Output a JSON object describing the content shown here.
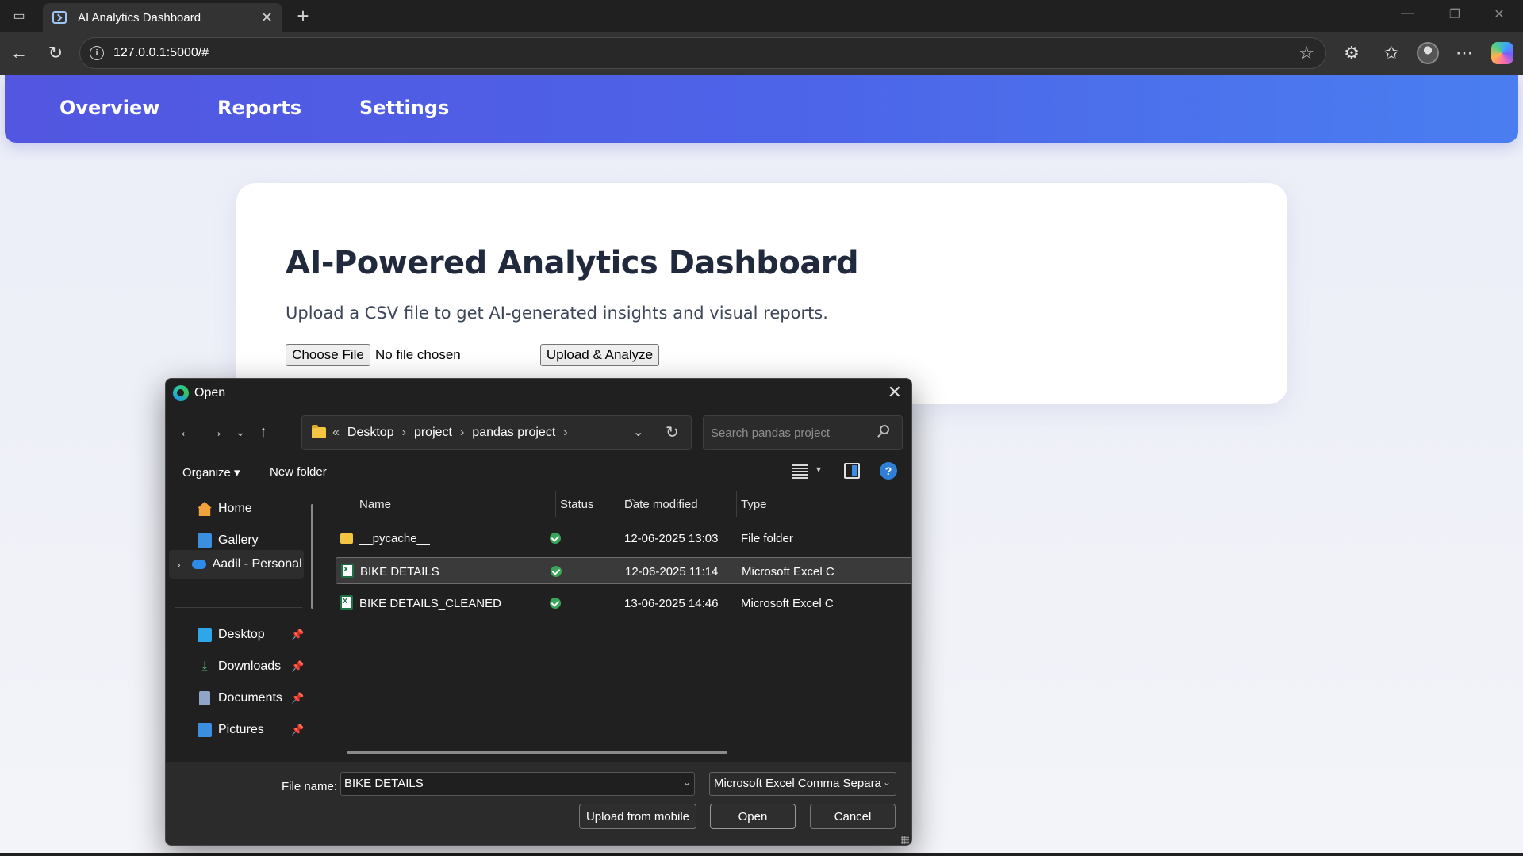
{
  "browser": {
    "tab_title": "AI Analytics Dashboard",
    "tab_close": "✕",
    "new_tab": "+",
    "url": "127.0.0.1:5000/#",
    "info_glyph": "i"
  },
  "nav": {
    "links": [
      "Overview",
      "Reports",
      "Settings"
    ]
  },
  "card": {
    "title": "AI-Powered Analytics Dashboard",
    "subtitle": "Upload a CSV file to get AI-generated insights and visual reports.",
    "choose_file_label": "Choose File",
    "no_file_text": "No file chosen",
    "upload_label": "Upload & Analyze"
  },
  "dialog": {
    "title": "Open",
    "close_glyph": "✕",
    "breadcrumb": [
      "Desktop",
      "project",
      "pandas project"
    ],
    "breadcrumb_prefix": "«",
    "search_placeholder": "Search pandas project",
    "organize_label": "Organize ▾",
    "new_folder_label": "New folder",
    "help_glyph": "?",
    "sidebar": {
      "home": "Home",
      "gallery": "Gallery",
      "onedrive": "Aadil - Personal",
      "desktop": "Desktop",
      "downloads": "Downloads",
      "documents": "Documents",
      "pictures": "Pictures"
    },
    "columns": {
      "name": "Name",
      "status": "Status",
      "date_modified": "Date modified",
      "type": "Type"
    },
    "files": [
      {
        "name": "__pycache__",
        "date": "12-06-2025 13:03",
        "type": "File folder",
        "icon": "folder-icon"
      },
      {
        "name": "BIKE DETAILS",
        "date": "12-06-2025 11:14",
        "type": "Microsoft Excel C",
        "icon": "excel-icon"
      },
      {
        "name": "BIKE DETAILS_CLEANED",
        "date": "13-06-2025 14:46",
        "type": "Microsoft Excel C",
        "icon": "excel-icon"
      }
    ],
    "file_name_label": "File name:",
    "file_name_value": "BIKE DETAILS",
    "file_type_value": "Microsoft Excel Comma Separa",
    "upload_mobile_label": "Upload from mobile",
    "open_label": "Open",
    "cancel_label": "Cancel"
  },
  "colors": {
    "nav_gradient_start": "#5256e0",
    "nav_gradient_end": "#4a7ef0",
    "dialog_bg": "#202020",
    "status_ok": "#3aa55a"
  }
}
